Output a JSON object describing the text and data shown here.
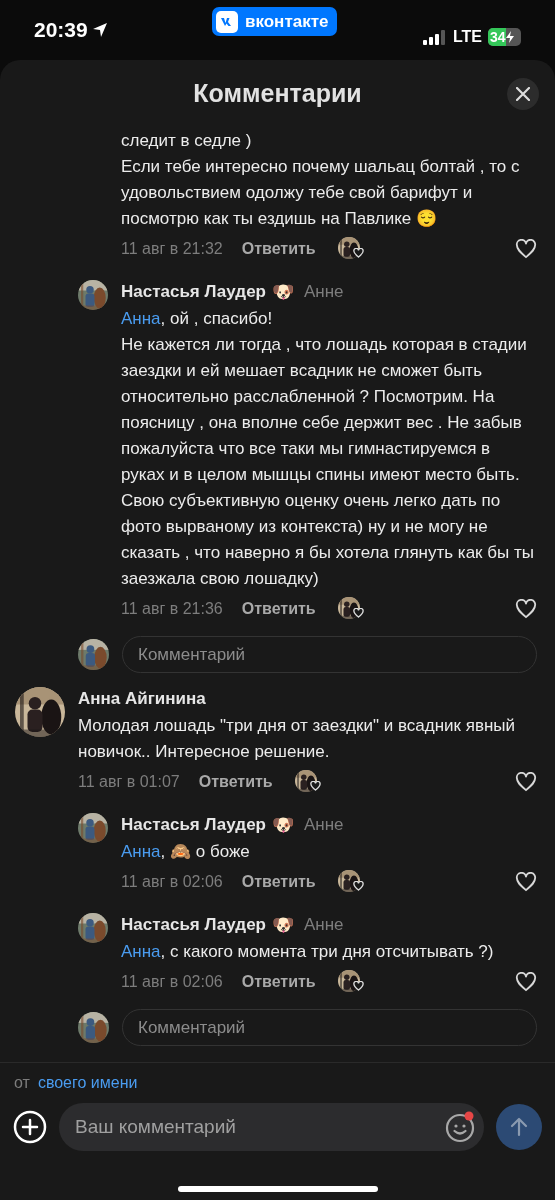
{
  "status_bar": {
    "time": "20:39",
    "app_badge": "вконтакте",
    "network": "LTE",
    "battery": "34"
  },
  "header": {
    "title": "Комментарии"
  },
  "comments": [
    {
      "kind": "tail",
      "text": "следит в седле )\nЕсли тебе интересно почему шальац болтай , то с удовольствием одолжу тебе свой барифут и посмотрю как ты ездишь на Павлике 😌",
      "time": "11 авг в 21:32",
      "reply": "Ответить"
    },
    {
      "kind": "reply",
      "author": "Настасья Лаудер",
      "badge": "🐶",
      "reply_to": "Анне",
      "mention": "Анна",
      "text": ", ой , спасибо!\nНе кажется ли тогда , что лошадь которая в стадии заездки и ей мешает всадник не сможет быть относительно расслабленной ? Посмотрим. На поясницу , она вполне себе держит вес . Не забыв пожалуйста что все таки мы гимнастируемся в руках и в целом мышцы спины имеют место быть. Свою субъективную оценку очень легко дать по фото вырваному из контекста) ну и не могу не сказать , что наверно я бы хотела глянуть как бы ты заезжала свою лошадку)",
      "time": "11 авг в 21:36",
      "reply": "Ответить"
    },
    {
      "kind": "field",
      "placeholder": "Комментарий"
    },
    {
      "kind": "comment",
      "author": "Анна Айгинина",
      "text": "Молодая лошадь \"три дня от заездки\" и всадник явный новичок.. Интересное решение.",
      "time": "11 авг в 01:07",
      "reply": "Ответить"
    },
    {
      "kind": "reply",
      "author": "Настасья Лаудер",
      "badge": "🐶",
      "reply_to": "Анне",
      "mention": "Анна",
      "text": ", 🙈 о боже",
      "time": "11 авг в 02:06",
      "reply": "Ответить"
    },
    {
      "kind": "reply",
      "author": "Настасья Лаудер",
      "badge": "🐶",
      "reply_to": "Анне",
      "mention": "Анна",
      "text": ", с какого момента три дня отсчитывать ?)",
      "time": "11 авг в 02:06",
      "reply": "Ответить"
    },
    {
      "kind": "field",
      "placeholder": "Комментарий"
    }
  ],
  "composer": {
    "from_label": "от",
    "from_link": "своего имени",
    "placeholder": "Ваш комментарий"
  }
}
